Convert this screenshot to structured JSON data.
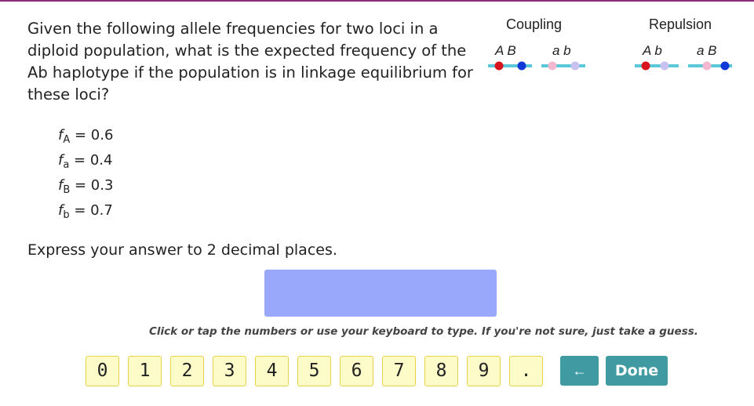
{
  "question": {
    "text": "Given the following allele frequencies for two loci in a diploid population, what is the expected frequency of the Ab haplotype if the population is in linkage equilibrium for these loci?"
  },
  "frequencies": [
    {
      "symbol": "f",
      "subscript": "A",
      "value": "= 0.6"
    },
    {
      "symbol": "f",
      "subscript": "a",
      "value": "= 0.4"
    },
    {
      "symbol": "f",
      "subscript": "B",
      "value": "= 0.3"
    },
    {
      "symbol": "f",
      "subscript": "b",
      "value": "= 0.7"
    }
  ],
  "instruction": "Express your answer to 2 decimal places.",
  "answer": {
    "value": ""
  },
  "hint": "Click or tap the numbers or use your keyboard to type. If you're not sure, just take a guess.",
  "keypad": {
    "keys": [
      "0",
      "1",
      "2",
      "3",
      "4",
      "5",
      "6",
      "7",
      "8",
      "9",
      "."
    ],
    "backspace": "←",
    "done": "Done"
  },
  "diagram": {
    "coupling": {
      "title": "Coupling",
      "left_label": "A B",
      "right_label": "a b"
    },
    "repulsion": {
      "title": "Repulsion",
      "left_label": "A b",
      "right_label": "a B"
    },
    "colors": {
      "line": "#5bc8d8",
      "A": "#d8141f",
      "a": "#f3b8cf",
      "B": "#1238d8",
      "b": "#c9c2f0"
    }
  }
}
